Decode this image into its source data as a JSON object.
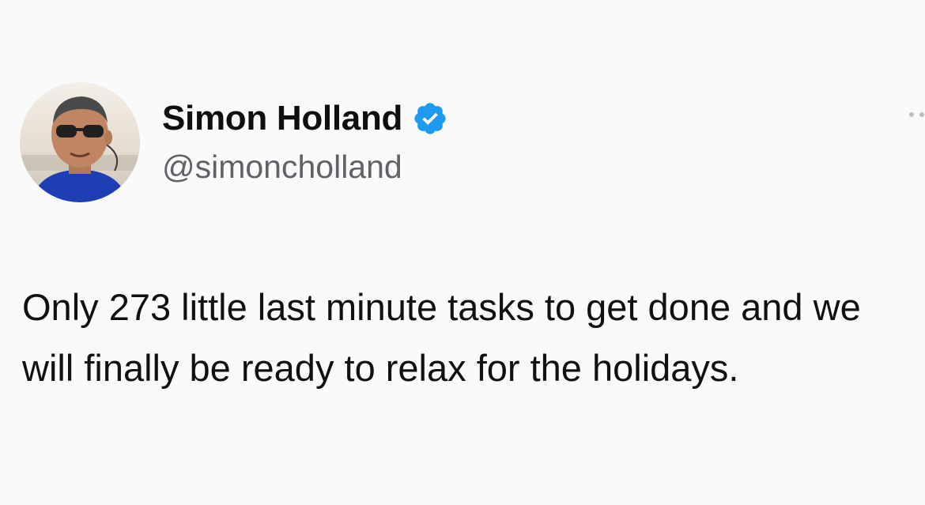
{
  "author": {
    "display_name": "Simon Holland",
    "handle": "@simoncholland",
    "verified": true,
    "verified_icon": "verified-badge-icon",
    "avatar_icon": "profile-photo"
  },
  "tweet": {
    "text": "Only 273 little last minute tasks to get done and we will finally be ready to relax for the holidays."
  },
  "colors": {
    "background": "#fafafa",
    "verified_blue": "#1d9bf0",
    "handle_gray": "#5f6368",
    "text": "#111111"
  },
  "more_icon": "more-options-icon"
}
